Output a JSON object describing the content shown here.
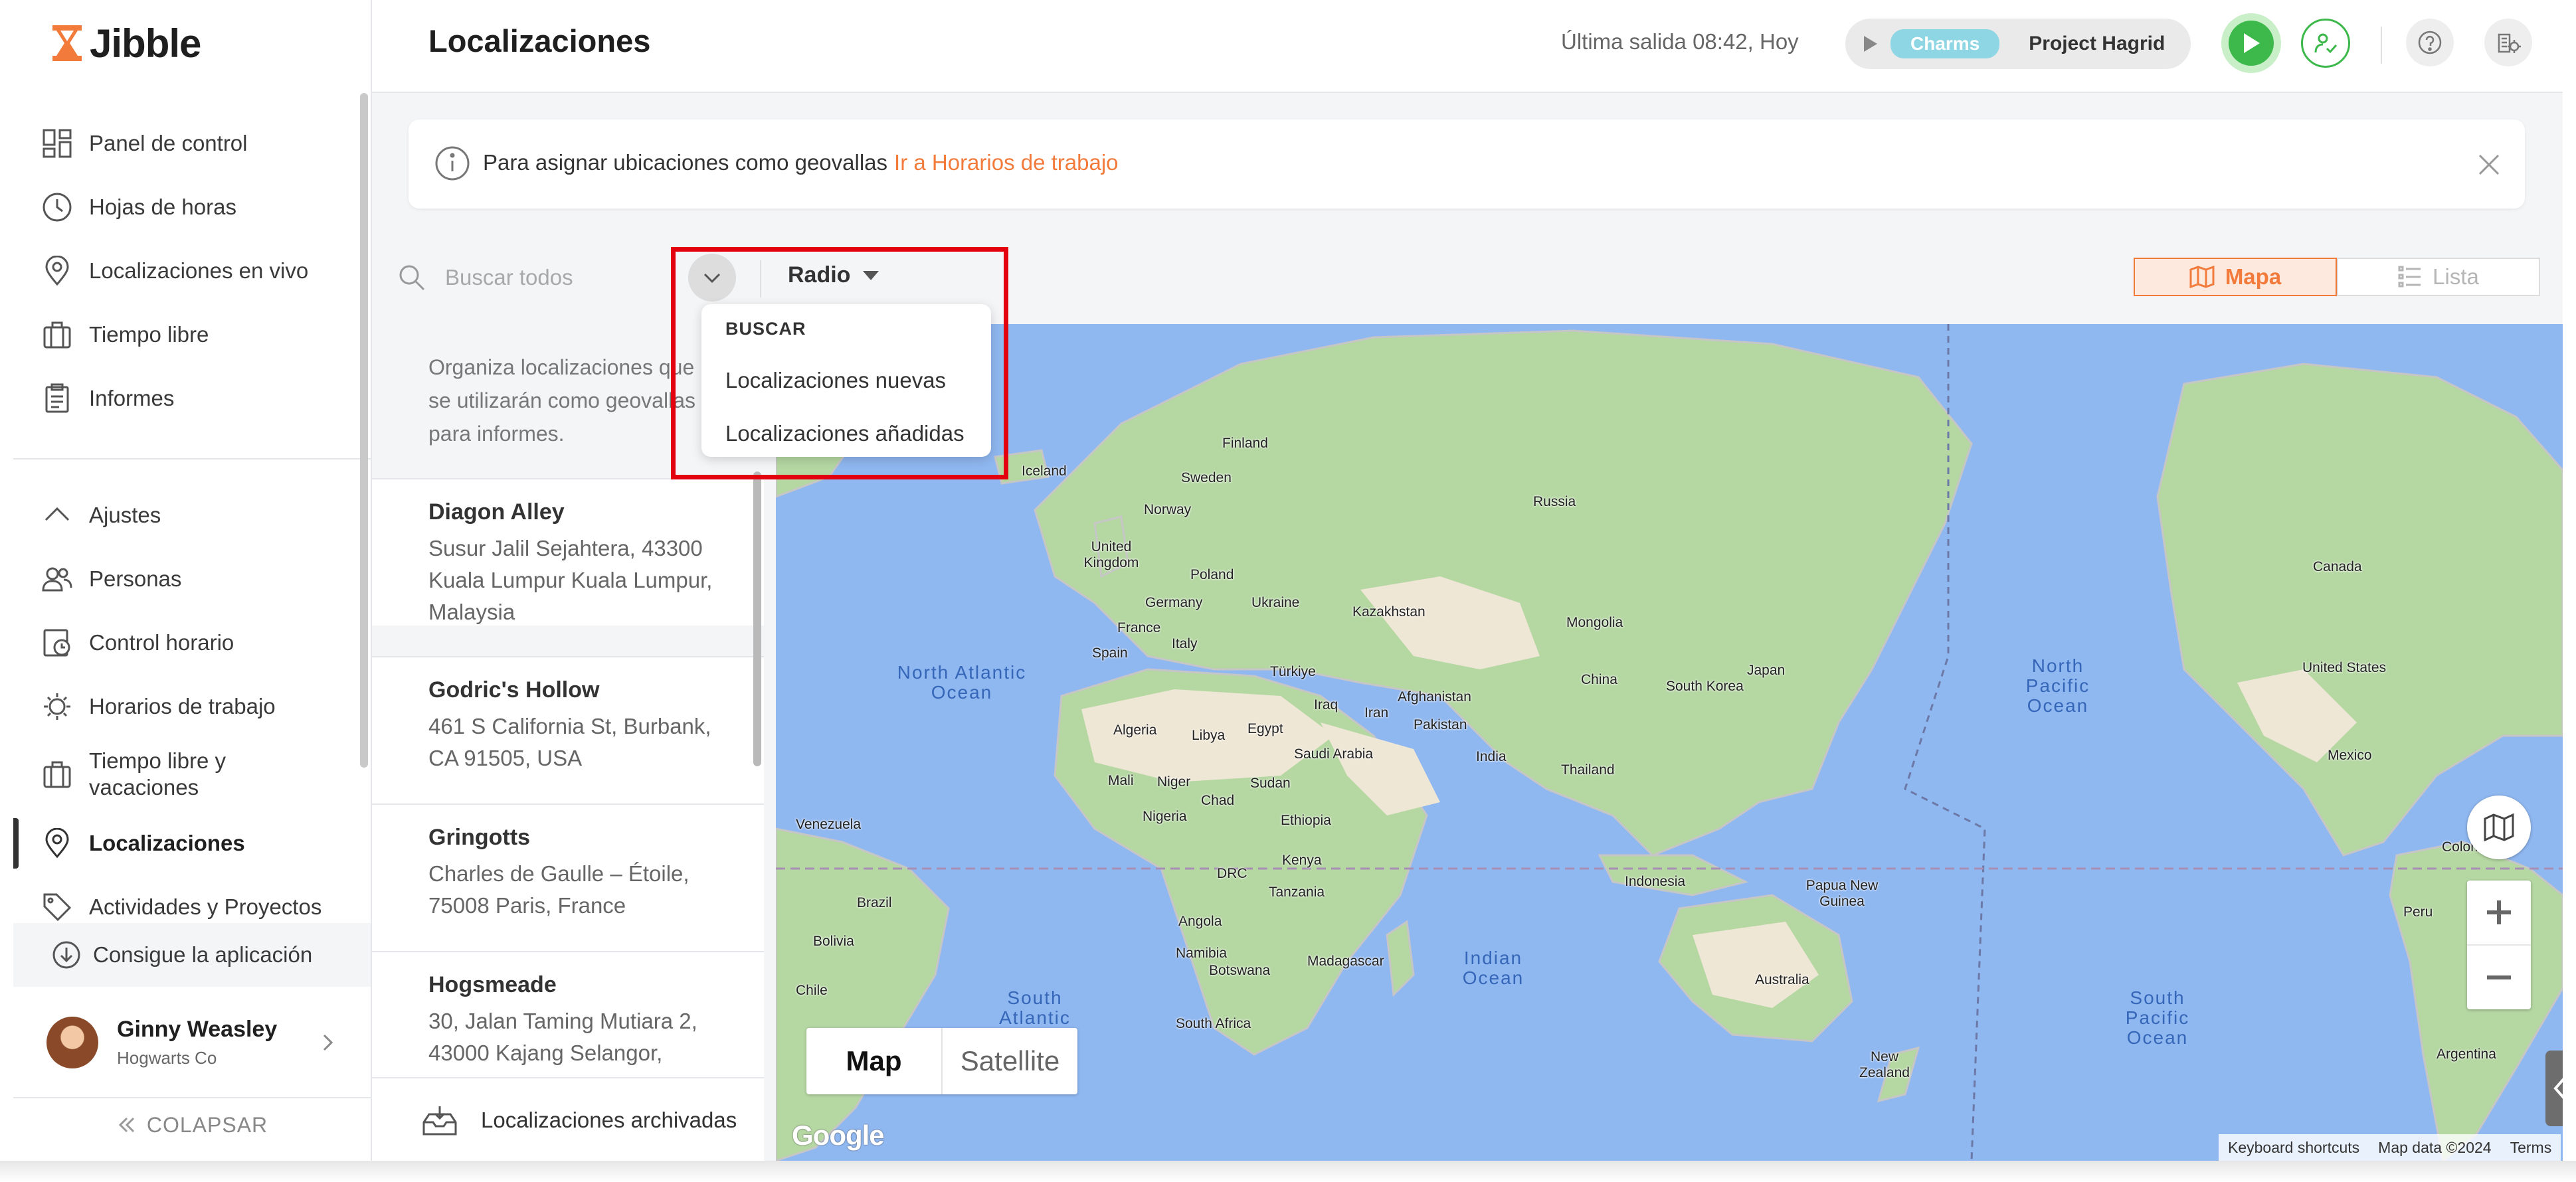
{
  "app": {
    "logo_text": "Jibble"
  },
  "sidebar": {
    "items": [
      {
        "label": "Panel de control",
        "icon": "dashboard-icon"
      },
      {
        "label": "Hojas de horas",
        "icon": "clock-icon"
      },
      {
        "label": "Localizaciones en vivo",
        "icon": "live-location-icon"
      },
      {
        "label": "Tiempo libre",
        "icon": "suitcase-icon"
      },
      {
        "label": "Informes",
        "icon": "clipboard-icon"
      }
    ],
    "settings_header": "Ajustes",
    "settings_items": [
      {
        "label": "Personas",
        "icon": "people-icon"
      },
      {
        "label": "Control horario",
        "icon": "time-tracking-icon"
      },
      {
        "label": "Horarios de trabajo",
        "icon": "work-schedule-icon"
      },
      {
        "label": "Tiempo libre y vacaciones",
        "icon": "vacation-icon"
      },
      {
        "label": "Localizaciones",
        "icon": "location-pin-icon",
        "active": true
      },
      {
        "label": "Actividades y Proyectos",
        "icon": "tag-icon"
      }
    ],
    "get_app": "Consigue la aplicación",
    "user": {
      "name": "Ginny Weasley",
      "org": "Hogwarts Co"
    },
    "collapse": "COLAPSAR"
  },
  "header": {
    "title": "Localizaciones",
    "last_out": "Última salida 08:42, Hoy",
    "activity_tag": "Charms",
    "project": "Project Hagrid"
  },
  "banner": {
    "text": "Para asignar ubicaciones como geovallas",
    "link": "Ir a Horarios de trabajo"
  },
  "toolbar": {
    "search_placeholder": "Buscar todos",
    "radio_label": "Radio",
    "view_map": "Mapa",
    "view_list": "Lista"
  },
  "dropdown": {
    "header": "BUSCAR",
    "items": [
      "Localizaciones nuevas",
      "Localizaciones añadidas"
    ]
  },
  "list": {
    "intro": "Organiza localizaciones que se utilizarán como geovallas para informes.",
    "locations": [
      {
        "name": "Diagon Alley",
        "address": "Susur Jalil Sejahtera, 43300 Kuala Lumpur Kuala Lumpur, Malaysia"
      },
      {
        "name": "Godric's Hollow",
        "address": "461 S California St, Burbank, CA 91505, USA"
      },
      {
        "name": "Gringotts",
        "address": "Charles de Gaulle – Étoile, 75008 Paris, France"
      },
      {
        "name": "Hogsmeade",
        "address": "30, Jalan Taming Mutiara 2, 43000 Kajang Selangor,"
      }
    ],
    "archived": "Localizaciones archivadas"
  },
  "map": {
    "oceans": [
      {
        "label": "North Atlantic Ocean"
      },
      {
        "label": "North Pacific Ocean"
      },
      {
        "label": "Indian Ocean"
      },
      {
        "label": "South Atlantic Ocean"
      },
      {
        "label": "South Pacific Ocean"
      }
    ],
    "countries": [
      "Finland",
      "Sweden",
      "Norway",
      "Iceland",
      "United Kingdom",
      "Poland",
      "Germany",
      "Ukraine",
      "France",
      "Spain",
      "Italy",
      "Russia",
      "Kazakhstan",
      "Mongolia",
      "Türkiye",
      "Iraq",
      "Iran",
      "Afghanistan",
      "Pakistan",
      "China",
      "South Korea",
      "Japan",
      "India",
      "Thailand",
      "Algeria",
      "Libya",
      "Egypt",
      "Saudi Arabia",
      "Mali",
      "Niger",
      "Chad",
      "Sudan",
      "Nigeria",
      "Ethiopia",
      "Kenya",
      "DRC",
      "Tanzania",
      "Angola",
      "Namibia",
      "Botswana",
      "Madagascar",
      "South Africa",
      "Indonesia",
      "Papua New Guinea",
      "Australia",
      "New Zealand",
      "Canada",
      "United States",
      "Mexico",
      "Venezuela",
      "Colombia",
      "Brazil",
      "Peru",
      "Bolivia",
      "Chile",
      "Argentina"
    ],
    "map_type": [
      "Map",
      "Satellite"
    ],
    "brand": "Google",
    "attribution": [
      "Keyboard shortcuts",
      "Map data ©2024",
      "Terms"
    ]
  },
  "colors": {
    "accent": "#f27b3c",
    "play": "#3cb94a",
    "highlight": "#e3000f"
  }
}
